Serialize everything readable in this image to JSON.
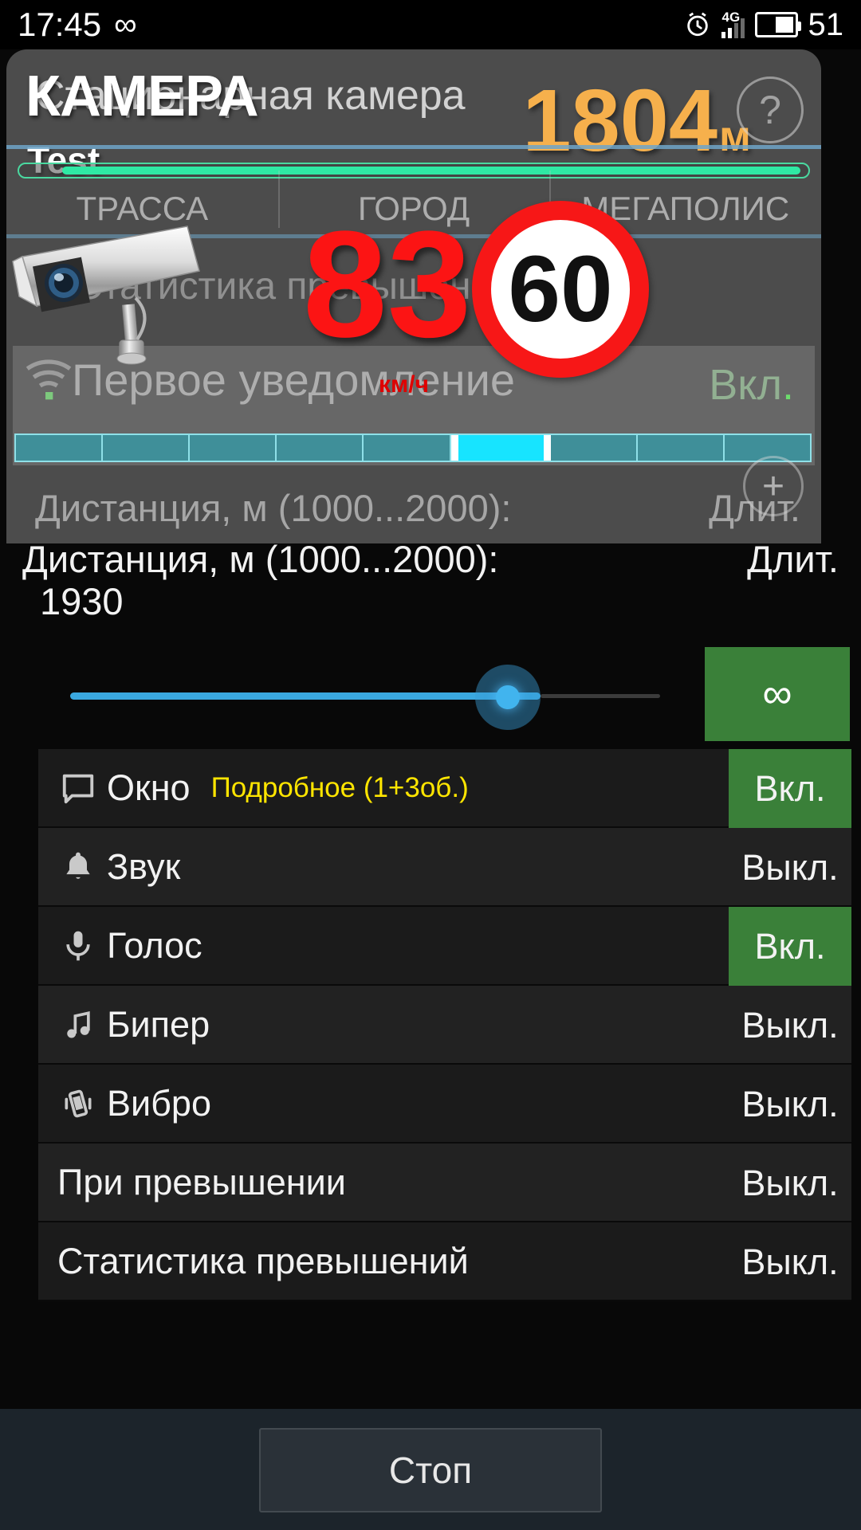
{
  "statusbar": {
    "time": "17:45",
    "infinity": "∞",
    "alarm_icon": "alarm-clock-icon",
    "network": "4G",
    "battery_percent": "51"
  },
  "popup": {
    "kamera_label": "КАМЕРА",
    "camera_type": "Стационарная камера",
    "test_label": "Test",
    "distance_value": "1804",
    "distance_unit": "м",
    "help_label": "?",
    "tabs": [
      "ТРАССА",
      "ГОРОД",
      "МЕГАПОЛИС"
    ],
    "stats_label": "Статистика превышений",
    "notification_label": "Первое уведомление",
    "notification_state": "Вкл",
    "notification_state_dot": ".",
    "distance_range_label": "Дистанция, м (1000...2000):",
    "duration_label": "Длит.",
    "plus_label": "+",
    "current_speed": "83",
    "speed_unit": "км/ч",
    "speed_limit": "60",
    "segments_total": 9,
    "segment_active_index": 5,
    "progress_percent": 93
  },
  "settings": {
    "distance_header": "Дистанция, м (1000...2000):",
    "duration_header": "Длит.",
    "distance_value": "1930",
    "slider_percent": 84,
    "duration_button": "∞",
    "rows": [
      {
        "icon": "window-icon",
        "label": "Окно",
        "sub": "Подробное (1+3об.)",
        "state": "Вкл.",
        "on": true
      },
      {
        "icon": "bell-icon",
        "label": "Звук",
        "sub": "",
        "state": "Выкл.",
        "on": false
      },
      {
        "icon": "microphone-icon",
        "label": "Голос",
        "sub": "",
        "state": "Вкл.",
        "on": true
      },
      {
        "icon": "music-note-icon",
        "label": "Бипер",
        "sub": "",
        "state": "Выкл.",
        "on": false
      },
      {
        "icon": "vibrate-icon",
        "label": "Вибро",
        "sub": "",
        "state": "Выкл.",
        "on": false
      },
      {
        "icon": "",
        "label": "При превышении",
        "sub": "",
        "state": "Выкл.",
        "on": false
      },
      {
        "icon": "",
        "label": "Статистика превышений",
        "sub": "",
        "state": "Выкл.",
        "on": false
      }
    ]
  },
  "footer": {
    "stop_button": "Стоп"
  },
  "colors": {
    "accent_blue": "#3aa8e0",
    "on_green": "#3a8039",
    "distance_orange": "#f6b04c",
    "speed_red": "#fc1414",
    "sub_yellow": "#ffe500",
    "progress_green": "#2fe9a4",
    "segment_cyan": "#17e4ff"
  }
}
